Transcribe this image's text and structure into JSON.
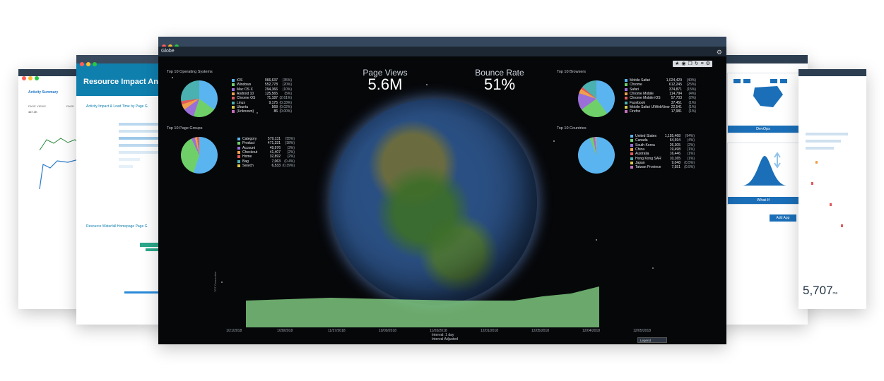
{
  "back_left": {
    "title": "Activity Summary",
    "labels": [
      "PAGE VIEWS",
      "467.3K",
      "PAGE"
    ]
  },
  "left": {
    "title": "Resource Impact Ana",
    "chart1_title": "Activity Impact & Load Time by Page G",
    "chart2_title": "Resource Waterfall Homepage Page G"
  },
  "main": {
    "window_title": "Globe",
    "toolbar_icons": [
      "star-icon",
      "circle-icon",
      "copy-icon",
      "refresh-icon",
      "layers-icon",
      "gear-icon"
    ],
    "metrics": [
      {
        "label": "Page Views",
        "value": "5.6M"
      },
      {
        "label": "Bounce Rate",
        "value": "51%"
      }
    ],
    "panels": {
      "os": {
        "title": "Top 10 Operating Systems",
        "rows": [
          {
            "name": "iOS",
            "value": "966,637",
            "pct": "(35%)",
            "color": "#5ab4f0"
          },
          {
            "name": "Windows",
            "value": "552,778",
            "pct": "(20%)",
            "color": "#6fd06a"
          },
          {
            "name": "Mac OS X",
            "value": "294,366",
            "pct": "(10%)",
            "color": "#9b6fd8"
          },
          {
            "name": "Android 10",
            "value": "125,565",
            "pct": "(5%)",
            "color": "#f0a04b"
          },
          {
            "name": "Chrome OS",
            "value": "71,187",
            "pct": "(2.61%)",
            "color": "#e05a5a"
          },
          {
            "name": "Linux",
            "value": "9,175",
            "pct": "(0.33%)",
            "color": "#4ab0b0"
          },
          {
            "name": "Ubuntu",
            "value": "568",
            "pct": "(0.02%)",
            "color": "#d8c94a"
          },
          {
            "name": "(Unknown)",
            "value": "86",
            "pct": "(0.00%)",
            "color": "#c86fbf"
          }
        ]
      },
      "browsers": {
        "title": "Top 10 Browsers",
        "rows": [
          {
            "name": "Mobile Safari",
            "value": "1,024,429",
            "pct": "(40%)",
            "color": "#5ab4f0"
          },
          {
            "name": "Chrome",
            "value": "612,245",
            "pct": "(25%)",
            "color": "#6fd06a"
          },
          {
            "name": "Safari",
            "value": "374,871",
            "pct": "(15%)",
            "color": "#9b6fd8"
          },
          {
            "name": "Chrome Mobile",
            "value": "114,794",
            "pct": "(4%)",
            "color": "#f0a04b"
          },
          {
            "name": "Chrome Mobile iOS",
            "value": "57,703",
            "pct": "(2%)",
            "color": "#e05a5a"
          },
          {
            "name": "Facebook",
            "value": "37,451",
            "pct": "(1%)",
            "color": "#4ab0b0"
          },
          {
            "name": "Mobile Safari UIWebView",
            "value": "22,541",
            "pct": "(1%)",
            "color": "#d8c94a"
          },
          {
            "name": "Firefox",
            "value": "17,981",
            "pct": "(1%)",
            "color": "#c86fbf"
          }
        ]
      },
      "page_groups": {
        "title": "Top 10 Page Groups",
        "rows": [
          {
            "name": "Category",
            "value": "579,131",
            "pct": "(55%)",
            "color": "#5ab4f0"
          },
          {
            "name": "Product",
            "value": "471,331",
            "pct": "(38%)",
            "color": "#6fd06a"
          },
          {
            "name": "Account",
            "value": "49,976",
            "pct": "(3%)",
            "color": "#9b6fd8"
          },
          {
            "name": "Checkout",
            "value": "41,407",
            "pct": "(2%)",
            "color": "#f0a04b"
          },
          {
            "name": "Home",
            "value": "32,892",
            "pct": "(2%)",
            "color": "#e05a5a"
          },
          {
            "name": "Bag",
            "value": "7,063",
            "pct": "(0.4%)",
            "color": "#4ab0b0"
          },
          {
            "name": "Search",
            "value": "6,533",
            "pct": "(0.39%)",
            "color": "#d8c94a"
          }
        ]
      },
      "countries": {
        "title": "Top 10 Countries",
        "rows": [
          {
            "name": "United States",
            "value": "1,155,468",
            "pct": "(94%)",
            "color": "#5ab4f0"
          },
          {
            "name": "Canada",
            "value": "64,594",
            "pct": "(4%)",
            "color": "#6fd06a"
          },
          {
            "name": "South Korea",
            "value": "26,305",
            "pct": "(2%)",
            "color": "#9b6fd8"
          },
          {
            "name": "China",
            "value": "19,498",
            "pct": "(1%)",
            "color": "#f0a04b"
          },
          {
            "name": "Australia",
            "value": "16,446",
            "pct": "(1%)",
            "color": "#e05a5a"
          },
          {
            "name": "Hong Kong SAR",
            "value": "10,165",
            "pct": "(1%)",
            "color": "#4ab0b0"
          },
          {
            "name": "Japan",
            "value": "9,048",
            "pct": "(0.5%)",
            "color": "#d8c94a"
          },
          {
            "name": "Taiwan Province",
            "value": "7,551",
            "pct": "(0.5%)",
            "color": "#c86fbf"
          }
        ]
      }
    },
    "timeline": {
      "x_labels": [
        "1/21/2018",
        "1/28/2018",
        "11/27/2018",
        "10/09/2018",
        "11/03/2018",
        "12/01/2018",
        "12/05/2018",
        "12/04/2018",
        "12/05/2018"
      ],
      "interval_label": "Interval: 1 day",
      "interval_sub": "Interval Adjusted",
      "legend_select": "Legend"
    }
  },
  "right": {
    "card1_label": "DevOps",
    "card2_label": "What-If",
    "add_app": "Add App"
  },
  "back_right": {
    "big_number": "5,707",
    "big_unit": "ms"
  }
}
